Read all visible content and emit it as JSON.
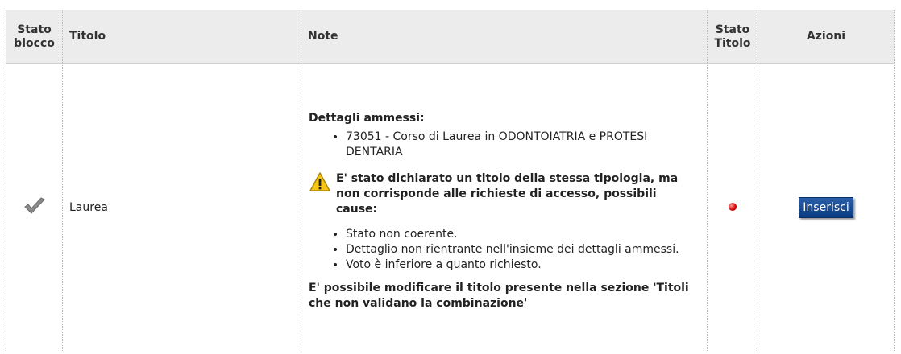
{
  "headers": {
    "stato_blocco": "Stato blocco",
    "titolo": "Titolo",
    "note": "Note",
    "stato_titolo": "Stato Titolo",
    "azioni": "Azioni"
  },
  "row": {
    "stato_blocco_icon": "check-icon",
    "titolo": "Laurea",
    "note": {
      "dettagli_heading": "Dettagli ammessi:",
      "dettagli_items": [
        "73051 - Corso di Laurea in ODONTOIATRIA e PROTESI DENTARIA"
      ],
      "warning_text": "E' stato dichiarato un titolo della stessa tipologia, ma non corrisponde alle richieste di accesso, possibili cause:",
      "cause_items": [
        "Stato non coerente.",
        "Dettaglio non rientrante nell'insieme dei dettagli ammessi.",
        "Voto è inferiore a quanto richiesto."
      ],
      "footer_text": "E' possibile modificare il titolo presente nella sezione 'Titoli che non validano la combinazione'"
    },
    "stato_titolo_icon": "red-status-dot",
    "stato_titolo_color": "#d10000",
    "azioni_button": "Inserisci"
  }
}
